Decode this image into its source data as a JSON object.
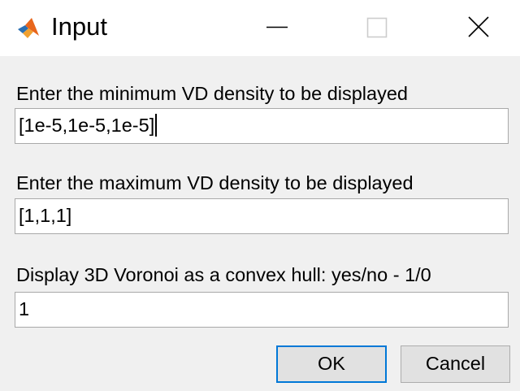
{
  "window": {
    "title": "Input",
    "controls": {
      "minimize_icon": "minimize-icon",
      "maximize_icon": "maximize-icon",
      "close_icon": "close-icon"
    },
    "app_icon": "matlab-icon"
  },
  "fields": [
    {
      "prompt": "Enter the minimum VD density to be displayed",
      "value": "[1e-5,1e-5,1e-5]"
    },
    {
      "prompt": "Enter the maximum VD density to be displayed",
      "value": "[1,1,1]"
    },
    {
      "prompt": "Display 3D Voronoi as a convex hull: yes/no - 1/0",
      "value": "1"
    }
  ],
  "buttons": {
    "ok_label": "OK",
    "cancel_label": "Cancel"
  },
  "colors": {
    "dialog_background": "#f0f0f0",
    "default_button_border": "#0078d7",
    "field_border": "#a9a9a9"
  }
}
